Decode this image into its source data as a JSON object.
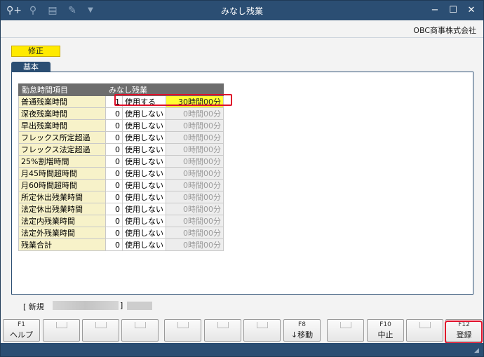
{
  "window": {
    "title": "みなし残業",
    "company": "OBC商事株式会社",
    "toolbar_icons": [
      "search-plus-icon",
      "zoom-icon",
      "printer-icon",
      "pen-tool-icon",
      "dropdown-arrow-icon"
    ]
  },
  "mode": {
    "label": "修正",
    "color": "#ffea00"
  },
  "tabs": [
    {
      "label": "基本",
      "active": true
    }
  ],
  "table": {
    "headers": {
      "item": "勤怠時間項目",
      "minashi": "みなし残業"
    },
    "rows": [
      {
        "name": "普通残業時間",
        "code": "1",
        "use": "使用する",
        "time": "30時間00分",
        "selected": true
      },
      {
        "name": "深夜残業時間",
        "code": "0",
        "use": "使用しない",
        "time": "0時間00分"
      },
      {
        "name": "早出残業時間",
        "code": "0",
        "use": "使用しない",
        "time": "0時間00分"
      },
      {
        "name": "フレックス所定超過",
        "code": "0",
        "use": "使用しない",
        "time": "0時間00分"
      },
      {
        "name": "フレックス法定超過",
        "code": "0",
        "use": "使用しない",
        "time": "0時間00分"
      },
      {
        "name": "25%割増時間",
        "code": "0",
        "use": "使用しない",
        "time": "0時間00分"
      },
      {
        "name": "月45時間超時間",
        "code": "0",
        "use": "使用しない",
        "time": "0時間00分"
      },
      {
        "name": "月60時間超時間",
        "code": "0",
        "use": "使用しない",
        "time": "0時間00分"
      },
      {
        "name": "所定休出残業時間",
        "code": "0",
        "use": "使用しない",
        "time": "0時間00分"
      },
      {
        "name": "法定休出残業時間",
        "code": "0",
        "use": "使用しない",
        "time": "0時間00分"
      },
      {
        "name": "法定内残業時間",
        "code": "0",
        "use": "使用しない",
        "time": "0時間00分"
      },
      {
        "name": "法定外残業時間",
        "code": "0",
        "use": "使用しない",
        "time": "0時間00分"
      },
      {
        "name": "残業合計",
        "code": "0",
        "use": "使用しない",
        "time": "0時間00分"
      }
    ]
  },
  "status": {
    "left_bracket": "[ 新規",
    "right_bracket": "]"
  },
  "function_keys": [
    {
      "key": "F1",
      "label": "ヘルプ"
    },
    {
      "key": "",
      "label": ""
    },
    {
      "key": "",
      "label": ""
    },
    {
      "key": "",
      "label": ""
    },
    {
      "key": "",
      "label": ""
    },
    {
      "key": "",
      "label": ""
    },
    {
      "key": "",
      "label": ""
    },
    {
      "key": "F8",
      "label": "↓移動"
    },
    {
      "key": "",
      "label": ""
    },
    {
      "key": "F10",
      "label": "中止"
    },
    {
      "key": "",
      "label": ""
    },
    {
      "key": "F12",
      "label": "登録"
    }
  ],
  "colors": {
    "accent": "#2b4e73",
    "highlight": "#e0102a",
    "selected_time": "#ffff33"
  }
}
